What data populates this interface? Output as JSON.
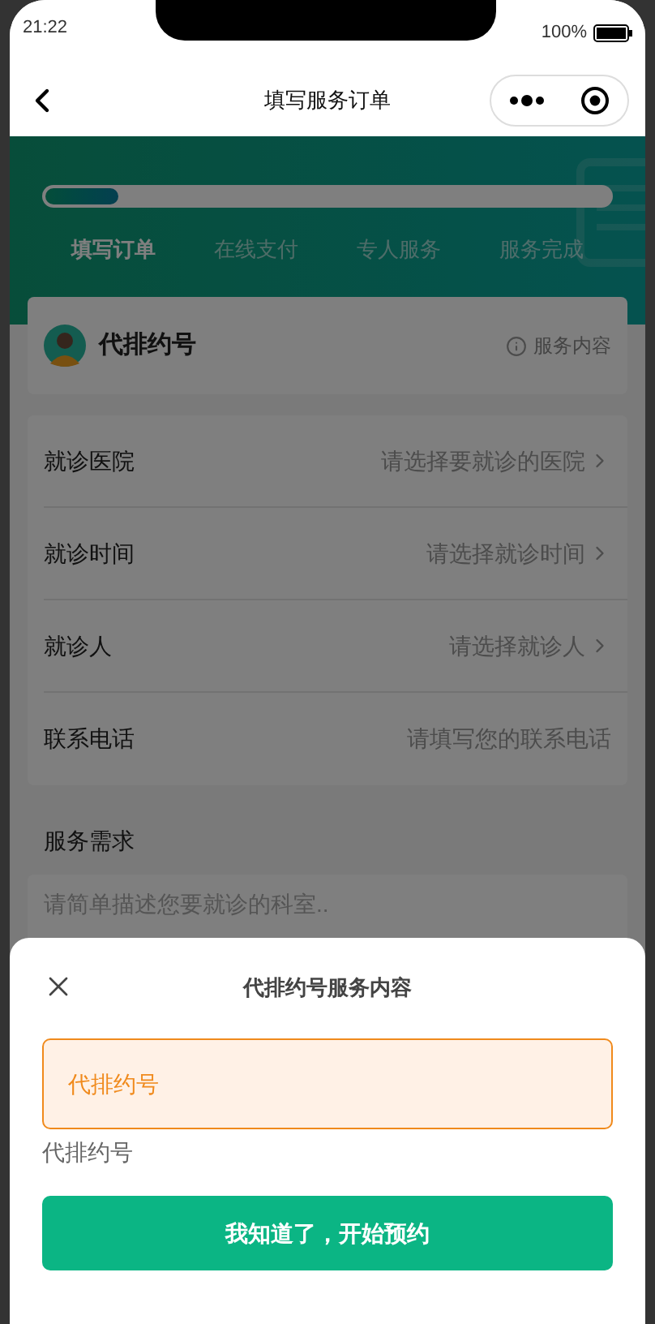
{
  "status_bar": {
    "time": "21:22",
    "battery": "100%"
  },
  "nav": {
    "title": "填写服务订单"
  },
  "progress": {
    "level": 0.13
  },
  "steps": [
    {
      "label": "填写订单",
      "selected": true
    },
    {
      "label": "在线支付",
      "selected": false
    },
    {
      "label": "专人服务",
      "selected": false
    },
    {
      "label": "服务完成",
      "selected": false
    }
  ],
  "service": {
    "name": "代排约号",
    "info_link": "服务内容"
  },
  "form": [
    {
      "label": "就诊医院",
      "placeholder": "请选择要就诊的医院",
      "kind": "select"
    },
    {
      "label": "就诊时间",
      "placeholder": "请选择就诊时间",
      "kind": "select"
    },
    {
      "label": "就诊人",
      "placeholder": "请选择就诊人",
      "kind": "select"
    },
    {
      "label": "联系电话",
      "placeholder": "请填写您的联系电话",
      "kind": "input"
    }
  ],
  "requirement": {
    "label": "服务需求",
    "placeholder": "请简单描述您要就诊的科室.."
  },
  "sheet": {
    "title": "代排约号服务内容",
    "options": [
      {
        "label": "代排约号",
        "selected": true
      }
    ],
    "description": "代排约号",
    "button": "我知道了，开始预约"
  }
}
